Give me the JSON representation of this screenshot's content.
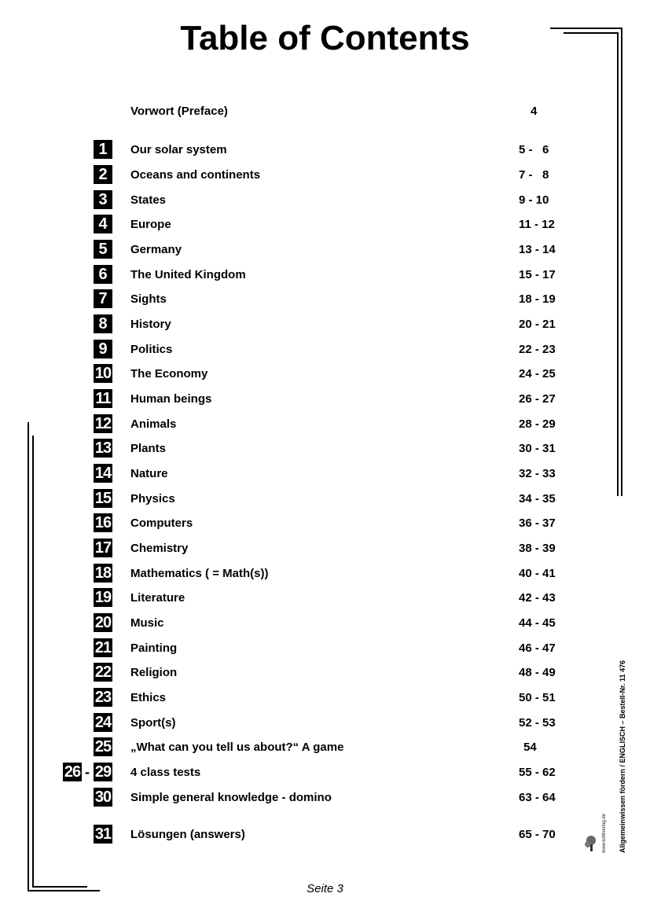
{
  "title": "Table of Contents",
  "preface": {
    "label": "Vorwort (Preface)",
    "pages": "4"
  },
  "entries": [
    {
      "num": "1",
      "label": "Our solar system",
      "pages": "5 -   6"
    },
    {
      "num": "2",
      "label": "Oceans and continents",
      "pages": "7 -   8"
    },
    {
      "num": "3",
      "label": "States",
      "pages": "9 - 10"
    },
    {
      "num": "4",
      "label": "Europe",
      "pages": "11 - 12"
    },
    {
      "num": "5",
      "label": "Germany",
      "pages": "13 - 14"
    },
    {
      "num": "6",
      "label": "The United Kingdom",
      "pages": "15 - 17"
    },
    {
      "num": "7",
      "label": "Sights",
      "pages": "18 - 19"
    },
    {
      "num": "8",
      "label": "History",
      "pages": "20 - 21"
    },
    {
      "num": "9",
      "label": "Politics",
      "pages": "22 - 23"
    },
    {
      "num": "10",
      "label": "The Economy",
      "pages": "24 - 25"
    },
    {
      "num": "11",
      "label": "Human beings",
      "pages": "26 - 27"
    },
    {
      "num": "12",
      "label": "Animals",
      "pages": "28 - 29"
    },
    {
      "num": "13",
      "label": "Plants",
      "pages": "30 - 31"
    },
    {
      "num": "14",
      "label": "Nature",
      "pages": "32 - 33"
    },
    {
      "num": "15",
      "label": "Physics",
      "pages": "34 - 35"
    },
    {
      "num": "16",
      "label": "Computers",
      "pages": "36 - 37"
    },
    {
      "num": "17",
      "label": "Chemistry",
      "pages": "38 - 39"
    },
    {
      "num": "18",
      "label": "Mathematics ( = Math(s))",
      "pages": "40 - 41"
    },
    {
      "num": "19",
      "label": "Literature",
      "pages": "42 - 43"
    },
    {
      "num": "20",
      "label": "Music",
      "pages": "44 - 45"
    },
    {
      "num": "21",
      "label": "Painting",
      "pages": "46 - 47"
    },
    {
      "num": "22",
      "label": "Religion",
      "pages": "48 - 49"
    },
    {
      "num": "23",
      "label": "Ethics",
      "pages": "50 - 51"
    },
    {
      "num": "24",
      "label": "Sport(s)",
      "pages": "52 - 53"
    },
    {
      "num": "25",
      "label": "„What can you tell us about?“ A game",
      "pages": "54"
    },
    {
      "num_from": "26",
      "num_to": "29",
      "label": "4 class tests",
      "pages": "55 - 62"
    },
    {
      "num": "30",
      "label": "Simple general knowledge - domino",
      "pages": "63 - 64"
    },
    {
      "num": "31",
      "label": "Lösungen (answers)",
      "pages": "65 - 70"
    }
  ],
  "footer": "Seite 3",
  "sidebar": {
    "text": "Allgemeinwissen fördern / ENGLISCH   –   Bestell-Nr. 11 476",
    "publisher": "KOHL VERLAG",
    "website": "www.kohlverlag.de"
  }
}
